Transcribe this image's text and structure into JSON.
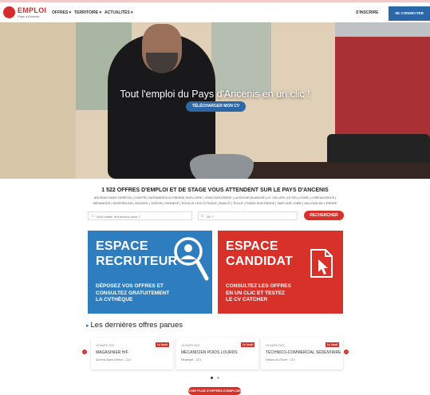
{
  "header": {
    "logo_title": "EMPLOI",
    "logo_subtitle": "Pays d'Ancenis",
    "nav": [
      "OFFRES ▾",
      "TERRITOIRE ▾",
      "ACTUALITÉS ▾"
    ],
    "signup_label": "S'INSCRIRE",
    "login_label": "SE CONNECTER"
  },
  "hero": {
    "title": "Tout l'emploi du Pays d'Ancenis en un clic !",
    "cta_label": "TÉLÉCHARGER MON CV"
  },
  "stats": {
    "title": "1 522 OFFRES D'EMPLOI ET DE STAGE VOUS ATTENDENT SUR LE PAYS D'ANCENIS",
    "towns": "ANCENIS-SAINT-GÉRÉON | COUFFÉ | INGRANDES-LE-FRESNE-SUR-LOIRE | JOUÉ-SUR-ERDRE | LA ROCHE-BLANCHE | LE CELLIER | LE PIN | LIGNÉ | LOIREAUXENCE | MÉSANGER | MONTRELAIS | MOUZEIL | OUDON | PANNECÉ | POUILLÉ-LES-COTEAUX | RIAILLÉ | TEILLÉ | TRANS-SUR-ERDRE | VAIR-SUR-LOIRE | VALLONS-DE-L'ERDRE"
  },
  "search": {
    "what_placeholder": "Quel métier recherchez-vous ?",
    "where_placeholder": "Où ?",
    "button_label": "RECHERCHER"
  },
  "espace_recruteur": {
    "title_line1": "ESPACE",
    "title_line2": "RECRUTEUR",
    "desc_line1": "DÉPOSEZ VOS OFFRES ET",
    "desc_line2": "CONSULTEZ GRATUITEMENT",
    "desc_line3": "LA CVTHÈQUE"
  },
  "espace_candidat": {
    "title_line1": "ESPACE",
    "title_line2": "CANDIDAT",
    "desc_line1": "CONSULTEZ LES OFFRES",
    "desc_line2": "EN UN CLIC ET TESTEZ",
    "desc_line3": "LE CV CATCHER"
  },
  "latest": {
    "title": "Les dernières offres parues",
    "more_label": "VOIR PLUS D'OFFRES D'EMPLOIS",
    "offers": [
      {
        "date": "15 MARS 2021",
        "badge": "Le local",
        "job": "MAGASINIER H/F",
        "location": "Ancenis-Saint-Géréon - CDI"
      },
      {
        "date": "15 MARS 2021",
        "badge": "Le local",
        "job": "MÉCANICIEN POIDS LOURDS",
        "location": "Mésanger - CDI"
      },
      {
        "date": "15 MARS 2021",
        "badge": "Le local",
        "job": "TECHNICO-COMMERCIAL SÉDENTAIRE",
        "location": "Vallons-de-l'Erdre - CDI"
      }
    ]
  },
  "colors": {
    "brand_red": "#d7312a",
    "brand_blue": "#2e7dbe"
  }
}
